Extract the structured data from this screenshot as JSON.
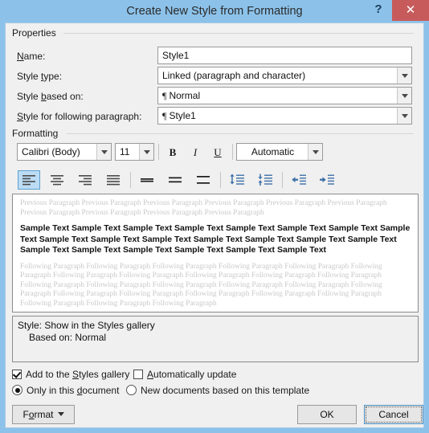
{
  "titlebar": {
    "title": "Create New Style from Formatting",
    "help_label": "?",
    "close_label": "✕"
  },
  "properties": {
    "group_label": "Properties",
    "name_label": "Name:",
    "name_value": "Style1",
    "style_type_label": "Style type:",
    "style_type_value": "Linked (paragraph and character)",
    "style_based_on_label": "Style based on:",
    "style_based_on_value": "Normal",
    "style_following_label": "Style for following paragraph:",
    "style_following_value": "Style1",
    "pilcrow": "¶"
  },
  "formatting": {
    "group_label": "Formatting",
    "font_family": "Calibri (Body)",
    "font_size": "11",
    "bold_label": "B",
    "italic_label": "I",
    "underline_label": "U",
    "font_color": "Automatic",
    "align_left": "align-left",
    "align_center": "align-center",
    "align_right": "align-right",
    "align_justify": "align-justify",
    "spacing_single": "line-spacing-single",
    "spacing_1_5": "line-spacing-1.5",
    "spacing_double": "line-spacing-double",
    "space_before": "increase-paragraph-spacing",
    "space_after": "decrease-paragraph-spacing",
    "decrease_indent": "decrease-indent",
    "increase_indent": "increase-indent"
  },
  "preview": {
    "previous_paragraph": "Previous Paragraph Previous Paragraph Previous Paragraph Previous Paragraph Previous Paragraph Previous Paragraph Previous Paragraph Previous Paragraph Previous Paragraph Previous Paragraph",
    "sample_text": "Sample Text Sample Text Sample Text Sample Text Sample Text Sample Text Sample Text Sample Text Sample Text Sample Text Sample Text Sample Text Sample Text Sample Text Sample Text Sample Text Sample Text Sample Text Sample Text Sample Text Sample Text",
    "following_paragraph": "Following Paragraph Following Paragraph Following Paragraph Following Paragraph Following Paragraph Following Paragraph Following Paragraph Following Paragraph Following Paragraph Following Paragraph Following Paragraph Following Paragraph Following Paragraph Following Paragraph Following Paragraph Following Paragraph Following Paragraph Following Paragraph Following Paragraph Following Paragraph Following Paragraph Following Paragraph Following Paragraph Following Paragraph Following Paragraph"
  },
  "description": {
    "line1": "Style: Show in the Styles gallery",
    "line2": "Based on: Normal"
  },
  "options": {
    "add_gallery_label": "Add to the Styles gallery",
    "add_gallery_checked": true,
    "auto_update_label": "Automatically update",
    "auto_update_checked": false,
    "only_this_doc_label": "Only in this document",
    "only_this_doc_selected": true,
    "new_docs_label": "New documents based on this template",
    "new_docs_selected": false
  },
  "buttons": {
    "format_label": "Format",
    "ok_label": "OK",
    "cancel_label": "Cancel"
  },
  "colors": {
    "titlebar_bg": "#8cc2ea",
    "close_bg": "#c75b5b",
    "dialog_bg": "#f0f0f0",
    "accent_icon": "#3d6fa8",
    "selected_btn": "#bcdcf5"
  }
}
